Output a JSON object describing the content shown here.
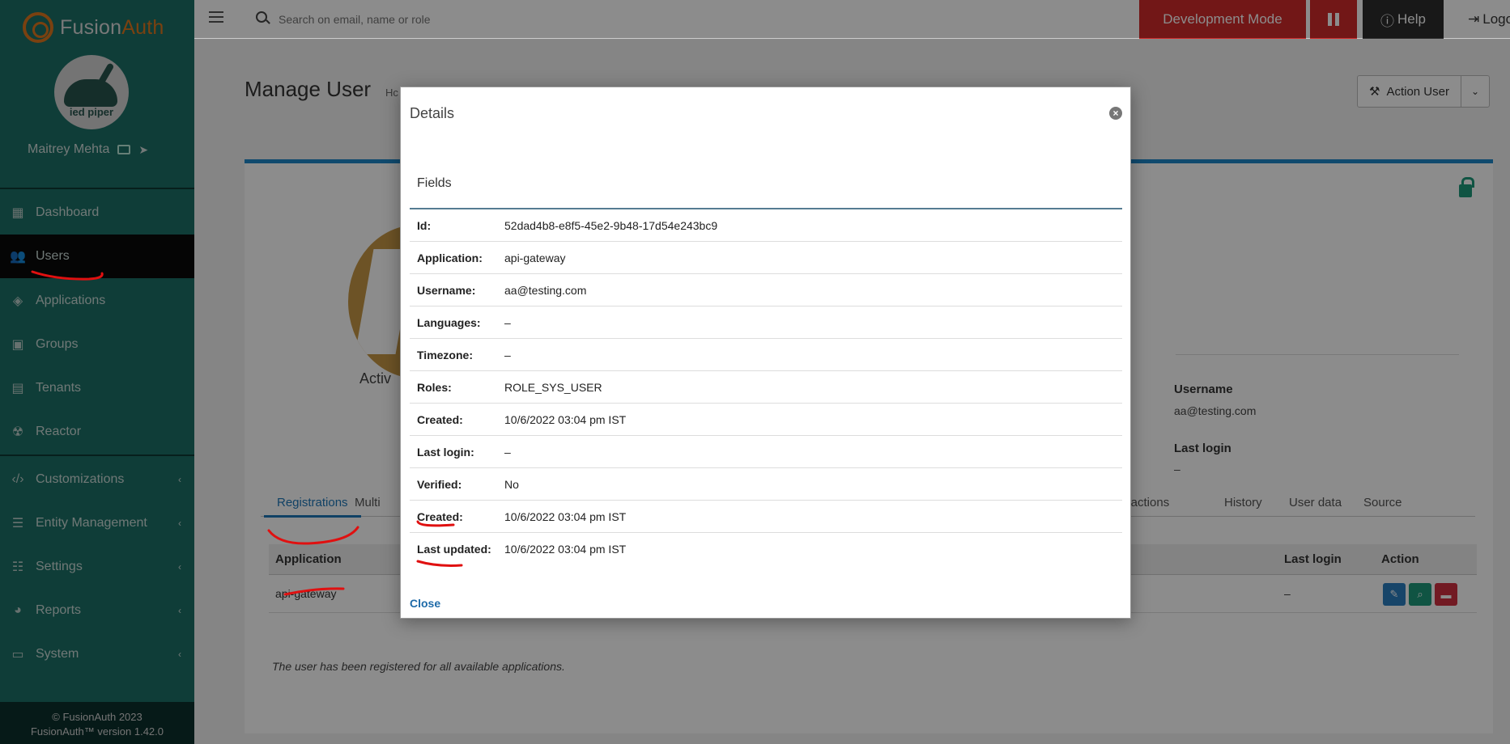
{
  "brand": {
    "name_part1": "Fusion",
    "name_part2": "Auth"
  },
  "sidebar": {
    "avatar_text": "ied piper",
    "user_name": "Maitrey Mehta",
    "items": [
      {
        "label": "Dashboard",
        "icon": "dashboard-icon"
      },
      {
        "label": "Users",
        "icon": "users-icon"
      },
      {
        "label": "Applications",
        "icon": "cube-icon"
      },
      {
        "label": "Groups",
        "icon": "groups-icon"
      },
      {
        "label": "Tenants",
        "icon": "building-icon"
      },
      {
        "label": "Reactor",
        "icon": "reactor-icon"
      },
      {
        "label": "Customizations",
        "icon": "code-icon"
      },
      {
        "label": "Entity Management",
        "icon": "entity-icon"
      },
      {
        "label": "Settings",
        "icon": "sliders-icon"
      },
      {
        "label": "Reports",
        "icon": "pie-chart-icon"
      },
      {
        "label": "System",
        "icon": "monitor-icon"
      }
    ],
    "footer_copyright": "© FusionAuth 2023",
    "footer_version": "FusionAuth™ version 1.42.0"
  },
  "topbar": {
    "search_placeholder": "Search on email, name or role",
    "dev_mode": "Development Mode",
    "help": "Help",
    "logout": "Logo"
  },
  "page": {
    "title": "Manage User",
    "breadcrumb_peek": "Hc",
    "action_user": "Action User",
    "active_peek": "Activ",
    "username_label": "Username",
    "username_value": "aa@testing.com",
    "last_login_label": "Last login",
    "last_login_value": "–",
    "tabs": [
      "Registrations",
      "Multi",
      "nt actions",
      "History",
      "User data",
      "Source"
    ],
    "table": {
      "headers": [
        "Application",
        "Last login",
        "Action"
      ],
      "row": {
        "application": "api-gateway",
        "last_login": "–"
      }
    },
    "note": "The user has been registered for all available applications."
  },
  "modal": {
    "title": "Details",
    "fields_heading": "Fields",
    "rows": [
      {
        "key": "Id:",
        "value": "52dad4b8-e8f5-45e2-9b48-17d54e243bc9"
      },
      {
        "key": "Application:",
        "value": "api-gateway"
      },
      {
        "key": "Username:",
        "value": "aa@testing.com"
      },
      {
        "key": "Languages:",
        "value": "–"
      },
      {
        "key": "Timezone:",
        "value": "–"
      },
      {
        "key": "Roles:",
        "value": "ROLE_SYS_USER"
      },
      {
        "key": "Created:",
        "value": "10/6/2022 03:04 pm IST"
      },
      {
        "key": "Last login:",
        "value": "–"
      },
      {
        "key": "Verified:",
        "value": "No"
      },
      {
        "key": "Created:",
        "value": "10/6/2022 03:04 pm IST"
      },
      {
        "key": "Last updated:",
        "value": "10/6/2022 03:04 pm IST"
      }
    ],
    "close_label": "Close"
  },
  "colors": {
    "sidebar": "#1e7a70",
    "accent_orange": "#f58320",
    "dev_red": "#d02a2a",
    "link_blue": "#1e6aa8",
    "annotation_red": "#e01010"
  }
}
